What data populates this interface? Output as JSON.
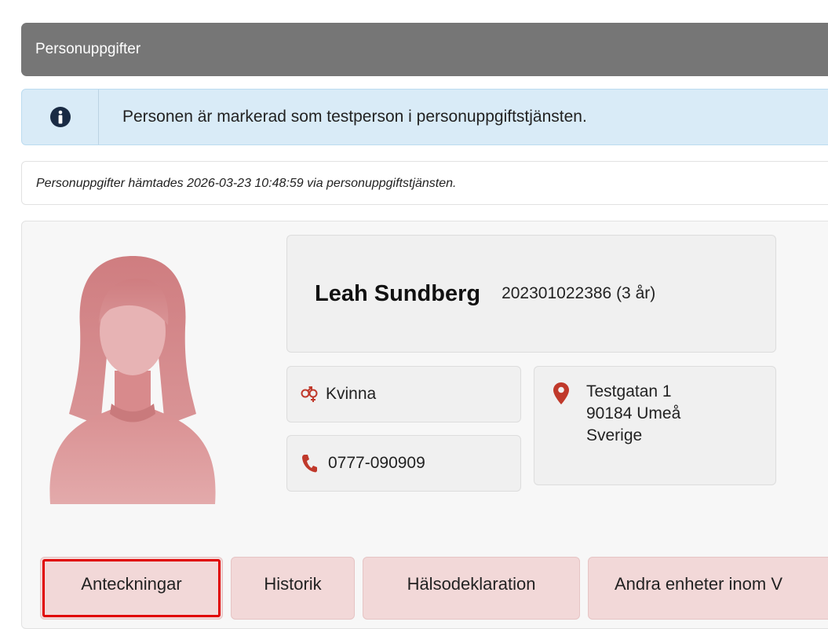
{
  "header": {
    "title": "Personuppgifter"
  },
  "alert": {
    "icon": "info-icon",
    "text": "Personen är markerad som testperson i personuppgiftstjänsten."
  },
  "fetched": {
    "text": "Personuppgifter hämtades 2026-03-23 10:48:59 via personuppgiftstjänsten."
  },
  "person": {
    "name": "Leah Sundberg",
    "id_age": "202301022386 (3 år)",
    "gender": "Kvinna",
    "phone": "0777-090909",
    "address": {
      "street": "Testgatan 1",
      "postal": "90184 Umeå",
      "country": "Sverige"
    }
  },
  "tabs": [
    {
      "label": "Anteckningar",
      "selected": true
    },
    {
      "label": "Historik",
      "selected": false
    },
    {
      "label": "Hälsodeklaration",
      "selected": false
    },
    {
      "label": "Andra enheter inom V",
      "selected": false
    }
  ],
  "colors": {
    "header_bg": "#767676",
    "alert_bg": "#d9ebf7",
    "icon_red": "#c0392b",
    "tab_bg": "#f2d8d8",
    "highlight": "#e00000",
    "avatar": "#d9898b"
  }
}
